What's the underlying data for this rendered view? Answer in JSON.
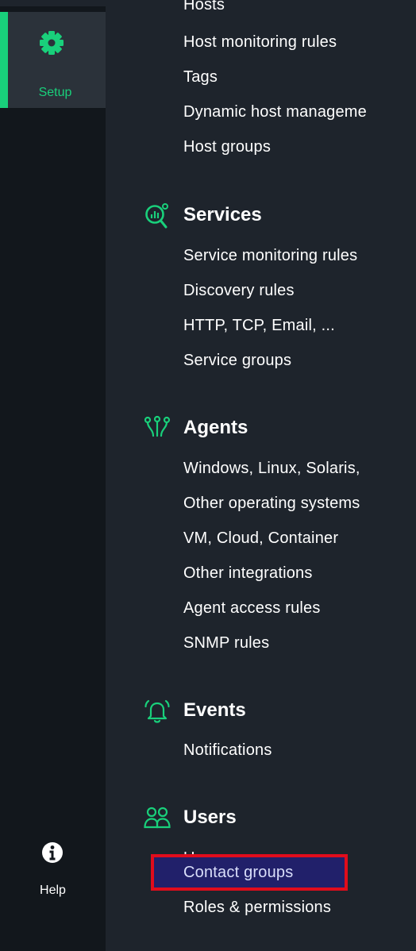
{
  "sidebar": {
    "setup_label": "Setup",
    "help_label": "Help",
    "accent_color": "#19d07b",
    "setup_icon": "gear-icon",
    "help_icon": "info-icon"
  },
  "hosts": {
    "items": [
      "Hosts",
      "Host monitoring rules",
      "Tags",
      "Dynamic host manageme",
      "Host groups"
    ]
  },
  "services": {
    "title": "Services",
    "icon": "services-magnifier-icon",
    "items": [
      "Service monitoring rules",
      "Discovery rules",
      "HTTP, TCP, Email, ...",
      "Service groups"
    ]
  },
  "agents": {
    "title": "Agents",
    "icon": "agents-icon",
    "items": [
      "Windows, Linux, Solaris,",
      "Other operating systems",
      "VM, Cloud, Container",
      "Other integrations",
      "Agent access rules",
      "SNMP rules"
    ]
  },
  "events": {
    "title": "Events",
    "icon": "bell-icon",
    "items": [
      "Notifications"
    ]
  },
  "users": {
    "title": "Users",
    "icon": "users-icon",
    "items": [
      "Users",
      "Contact groups",
      "Roles & permissions"
    ]
  },
  "highlight": {
    "border_color": "#e00c1c",
    "background": "#21206a"
  }
}
